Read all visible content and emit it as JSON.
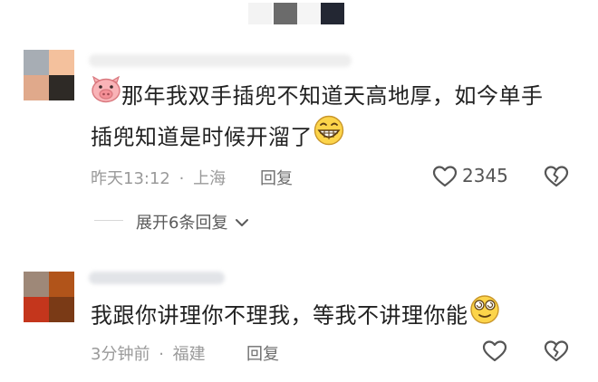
{
  "top_swatch_colors": [
    "#f3f3f3",
    "#6b6b6b",
    "#f5f5f5",
    "#232733"
  ],
  "comments": [
    {
      "avatar_colors": [
        "#a7adb4",
        "#f4c19d",
        "#e0a98b",
        "#2e2a26"
      ],
      "avatar_name": "avatar",
      "lead_icon": "pig-face-emoji-icon",
      "text_line1": "那年我双手插兜不知道天高地厚，如今单手",
      "text_line2": "插兜知道是时候开溜了",
      "trail_icon": "grinning-face-emoji-icon",
      "time": "昨天13:12",
      "separator": "·",
      "location": "上海",
      "reply_label": "回复",
      "like_count": "2345",
      "expand_label": "展开6条回复"
    },
    {
      "avatar_colors": [
        "#9e8878",
        "#b1541a",
        "#c4361c",
        "#7a3a16"
      ],
      "avatar_name": "avatar",
      "text_line1": "我跟你讲理你不理我，等我不讲理你能",
      "trail_icon": "dizzy-eyes-emoji-icon",
      "time": "3分钟前",
      "separator": "·",
      "location": "福建",
      "reply_label": "回复"
    }
  ]
}
